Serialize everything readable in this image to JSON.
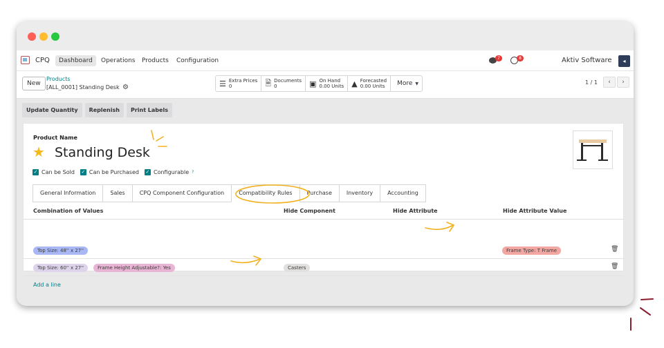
{
  "navbar": {
    "app_name": "CPQ",
    "items": [
      "Dashboard",
      "Operations",
      "Products",
      "Configuration"
    ],
    "messages_count": "7",
    "activities_count": "8",
    "company": "Aktiv Software"
  },
  "controlbar": {
    "new_label": "New",
    "breadcrumb_parent": "Products",
    "breadcrumb_current": "[ALL_0001] Standing Desk",
    "stats": [
      {
        "label": "Extra Prices",
        "value": "0"
      },
      {
        "label": "Documents",
        "value": "0"
      },
      {
        "label": "On Hand",
        "value": "0.00 Units"
      },
      {
        "label": "Forecasted",
        "value": "0.00 Units"
      }
    ],
    "more_label": "More",
    "pager": "1 / 1"
  },
  "actions": [
    "Update Quantity",
    "Replenish",
    "Print Labels"
  ],
  "form": {
    "product_name_label": "Product Name",
    "product_name": "Standing Desk",
    "checkboxes": [
      "Can be Sold",
      "Can be Purchased",
      "Configurable"
    ],
    "configurable_help": "?"
  },
  "tabs": [
    "General Information",
    "Sales",
    "CPQ Component Configuration",
    "Compatibility Rules",
    "Purchase",
    "Inventory",
    "Accounting"
  ],
  "active_tab": "Compatibility Rules",
  "table": {
    "headers": [
      "Combination of Values",
      "Hide Component",
      "Hide Attribute",
      "Hide Attribute Value"
    ],
    "rows": [
      {
        "combination": [
          "Top Size: 48'' x 27''"
        ],
        "hide_component": "",
        "hide_attribute": "",
        "hide_attribute_value": "Frame Type: T Frame"
      },
      {
        "combination": [
          "Top Size: 60'' x 27''",
          "Frame Height Adjustable?: Yes"
        ],
        "hide_component": "Casters",
        "hide_attribute": "",
        "hide_attribute_value": ""
      }
    ],
    "add_line": "Add a line"
  },
  "colors": {
    "accent": "#017e84",
    "annotation": "#f2b01e",
    "tag_blue": "#a9b8f5",
    "tag_lavender": "#ddd4ec",
    "tag_pink": "#e9b5d5",
    "tag_grey": "#e2e0de",
    "tag_red": "#f2a7a3"
  }
}
